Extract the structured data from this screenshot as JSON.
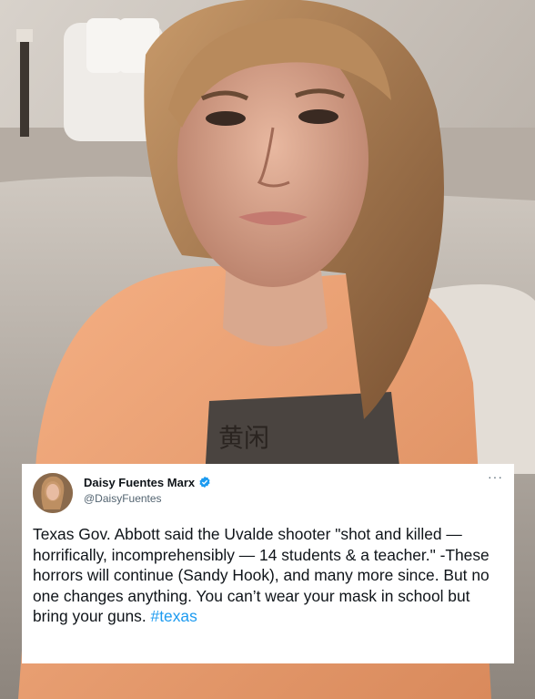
{
  "tweet": {
    "display_name": "Daisy Fuentes Marx",
    "handle": "@DaisyFuentes",
    "more_label": "···",
    "body_text": "Texas Gov. Abbott said the Uvalde shooter \"shot and killed — horrifically, incomprehensibly — 14 students & a teacher.\" -These horrors will continue (Sandy Hook), and many more since. But no one changes anything. You can’t wear your mask in school but bring your guns. ",
    "hashtag": "#texas",
    "verified_icon": "verified-badge-icon",
    "accent_color": "#1d9bf0"
  },
  "photo": {
    "shirt_print": "黄闲"
  }
}
